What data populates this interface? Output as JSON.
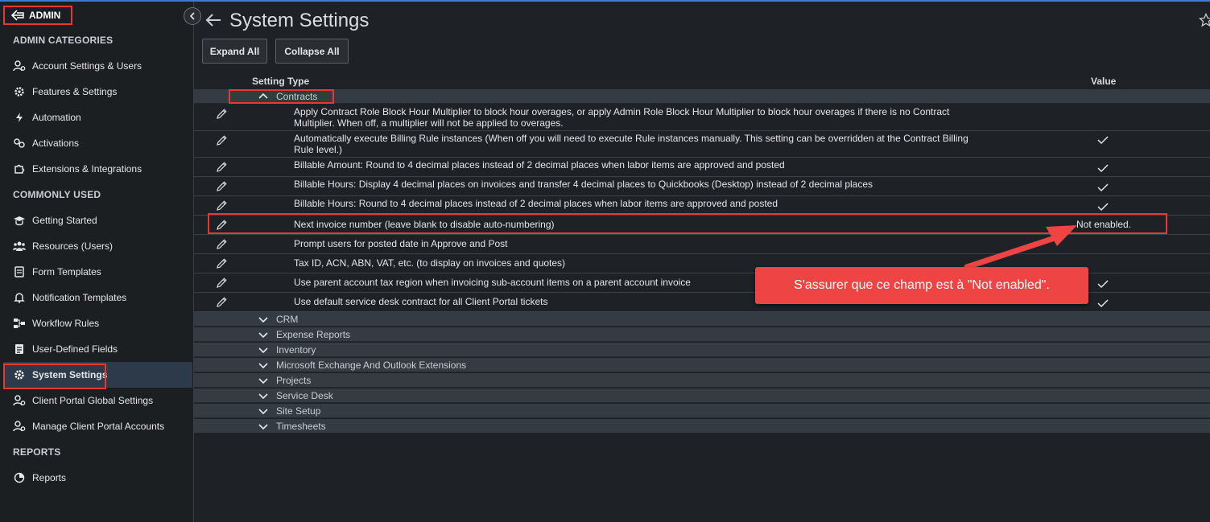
{
  "sidebar": {
    "admin_label": "ADMIN",
    "sections": {
      "admin_categories": "ADMIN CATEGORIES",
      "commonly_used": "COMMONLY USED",
      "reports": "REPORTS"
    },
    "items": [
      {
        "label": "Account Settings & Users",
        "icon": "users-gear-icon"
      },
      {
        "label": "Features & Settings",
        "icon": "gear-icon"
      },
      {
        "label": "Automation",
        "icon": "bolt-icon"
      },
      {
        "label": "Activations",
        "icon": "activations-icon"
      },
      {
        "label": "Extensions & Integrations",
        "icon": "puzzle-icon"
      },
      {
        "label": "Getting Started",
        "icon": "graduation-cap-icon"
      },
      {
        "label": "Resources (Users)",
        "icon": "users-icon"
      },
      {
        "label": "Form Templates",
        "icon": "document-icon"
      },
      {
        "label": "Notification Templates",
        "icon": "bell-icon"
      },
      {
        "label": "Workflow Rules",
        "icon": "workflow-icon"
      },
      {
        "label": "User-Defined Fields",
        "icon": "list-icon"
      },
      {
        "label": "System Settings",
        "icon": "gear-icon"
      },
      {
        "label": "Client Portal Global Settings",
        "icon": "users-gear-icon"
      },
      {
        "label": "Manage Client Portal Accounts",
        "icon": "users-gear-icon"
      },
      {
        "label": "Reports",
        "icon": "pie-chart-icon"
      }
    ]
  },
  "main": {
    "title": "System Settings",
    "buttons": {
      "expand_all": "Expand All",
      "collapse_all": "Collapse All"
    },
    "columns": {
      "setting_type": "Setting Type",
      "value": "Value"
    },
    "contracts": {
      "label": "Contracts",
      "rows": [
        {
          "text": "Apply Contract Role Block Hour Multiplier to block hour overages, or apply Admin Role Block Hour Multiplier to block hour overages if there is no Contract Multiplier. When off, a multiplier will not be applied to overages.",
          "checked": false
        },
        {
          "text": "Automatically execute Billing Rule instances (When off you will need to execute Rule instances manually. This setting can be overridden at the Contract Billing Rule level.)",
          "checked": true
        },
        {
          "text": "Billable Amount: Round to 4 decimal places instead of 2 decimal places when labor items are approved and posted",
          "checked": true
        },
        {
          "text": "Billable Hours: Display 4 decimal places on invoices and transfer 4 decimal places to Quickbooks (Desktop) instead of 2 decimal places",
          "checked": true
        },
        {
          "text": "Billable Hours: Round to 4 decimal places instead of 2 decimal places when labor items are approved and posted",
          "checked": true
        },
        {
          "text": "Next invoice number (leave blank to disable auto-numbering)",
          "value": "Not enabled."
        },
        {
          "text": "Prompt users for posted date in Approve and Post",
          "checked": false
        },
        {
          "text": "Tax ID, ACN, ABN, VAT, etc. (to display on invoices and quotes)",
          "checked": false
        },
        {
          "text": "Use parent account tax region when invoicing sub-account items on a parent account invoice",
          "checked": true
        },
        {
          "text": "Use default service desk contract for all Client Portal tickets",
          "checked": true
        }
      ]
    },
    "groups": [
      "CRM",
      "Expense Reports",
      "Inventory",
      "Microsoft Exchange And Outlook Extensions",
      "Projects",
      "Service Desk",
      "Site Setup",
      "Timesheets"
    ]
  },
  "annotation": {
    "callout_text": "S'assurer que ce champ est à \"Not enabled\".",
    "color": "#ef4444"
  }
}
